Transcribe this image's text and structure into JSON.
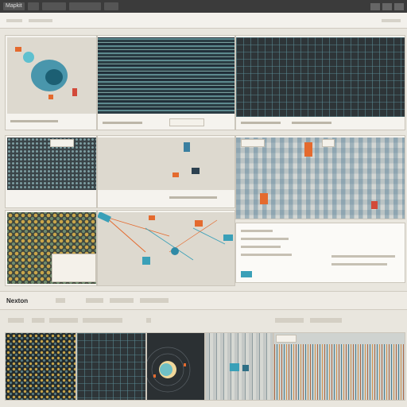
{
  "app": {
    "title": "Mapkit",
    "toolbar_items": [
      "",
      "",
      "",
      "",
      ""
    ]
  },
  "menubar": {
    "items": [
      "",
      "",
      "",
      ""
    ]
  },
  "section": {
    "heading": "Nexton"
  },
  "colors": {
    "accent": "#3aa0b8",
    "orange": "#e46a2e",
    "dark": "#2e3538",
    "panel": "#f5f3ee"
  }
}
